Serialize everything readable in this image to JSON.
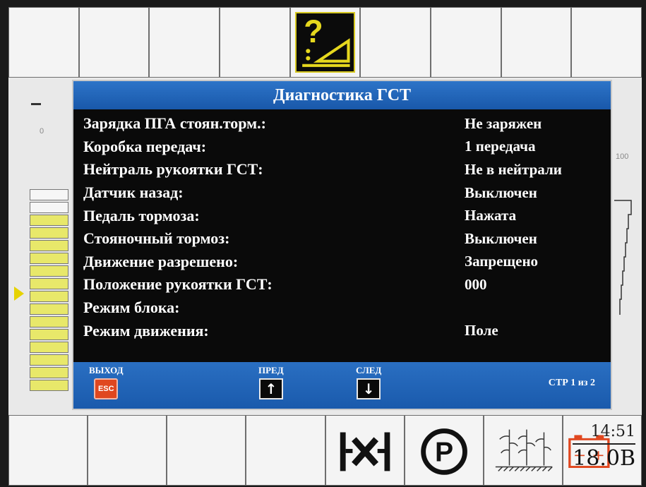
{
  "dialog": {
    "title": "Диагностика ГСТ",
    "rows": [
      {
        "label": "Зарядка ПГА стоян.торм.:",
        "value": "Не заряжен"
      },
      {
        "label": "Коробка передач:",
        "value": "1 передача"
      },
      {
        "label": "Нейтраль рукоятки ГСТ:",
        "value": "Не в нейтрали"
      },
      {
        "label": "Датчик назад:",
        "value": "Выключен"
      },
      {
        "label": "Педаль тормоза:",
        "value": "Нажата"
      },
      {
        "label": "Стояночный тормоз:",
        "value": "Выключен"
      },
      {
        "label": "Движение разрешено:",
        "value": "Запрещено"
      },
      {
        "label": "Положение рукоятки ГСТ:",
        "value": "000"
      },
      {
        "label": "Режим блока:",
        "value": ""
      },
      {
        "label": "Режим движения:",
        "value": "Поле"
      }
    ]
  },
  "footer": {
    "exit_label": "ВЫХОД",
    "esc_key": "ESC",
    "prev_label": "ПРЕД",
    "next_label": "СЛЕД",
    "prev_arrow": "↑",
    "next_arrow": "↓",
    "page_info": "СТР 1 из 2"
  },
  "top_buttons": {
    "active_icon": "help-slope-icon"
  },
  "bottom_buttons": {
    "icons": [
      "neutral-gear-icon",
      "parking-brake-icon",
      "crop-field-icon",
      "battery-icon"
    ],
    "parking_letter": "P",
    "battery_minus": "−",
    "battery_plus": "+",
    "time": "14:51",
    "voltage": "18.0В"
  },
  "gauges": {
    "left_scale_label": "0",
    "right_scale_label": "100"
  },
  "colors": {
    "title_bar": "#2d74c8",
    "dialog_bg": "#0a0a0a",
    "highlight_yellow": "#d6c820",
    "battery_red": "#e0471f"
  }
}
